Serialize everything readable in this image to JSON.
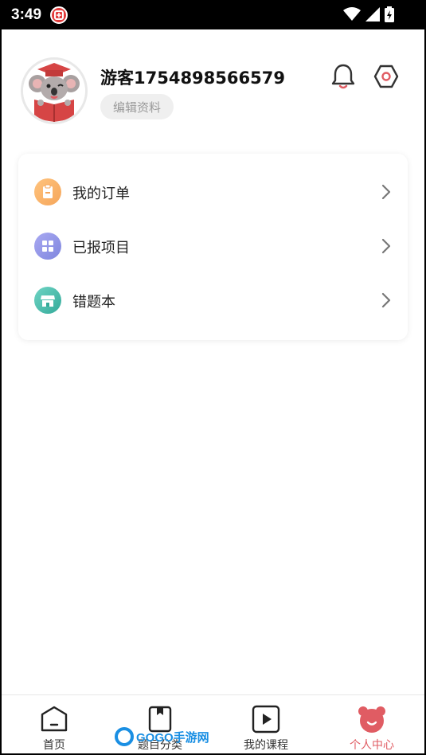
{
  "status_bar": {
    "time": "3:49",
    "notif_badge": "зҳӢ"
  },
  "profile": {
    "username": "游客1754898566579",
    "edit_label": "编辑资料"
  },
  "menu": {
    "items": [
      {
        "label": "我的订单",
        "icon": "clipboard-icon",
        "color": "#f5a65b"
      },
      {
        "label": "已报项目",
        "icon": "grid-icon",
        "color": "#8f8fe6"
      },
      {
        "label": "错题本",
        "icon": "store-icon",
        "color": "#3fb8a8"
      }
    ]
  },
  "tabbar": {
    "tabs": [
      {
        "label": "首页",
        "icon": "home-icon",
        "active": false
      },
      {
        "label": "题目分类",
        "icon": "book-icon",
        "active": false
      },
      {
        "label": "我的课程",
        "icon": "play-icon",
        "active": false
      },
      {
        "label": "个人中心",
        "icon": "bear-icon",
        "active": true
      }
    ],
    "active_color": "#e05c63"
  },
  "watermark": {
    "text": "GOGO手游网"
  }
}
